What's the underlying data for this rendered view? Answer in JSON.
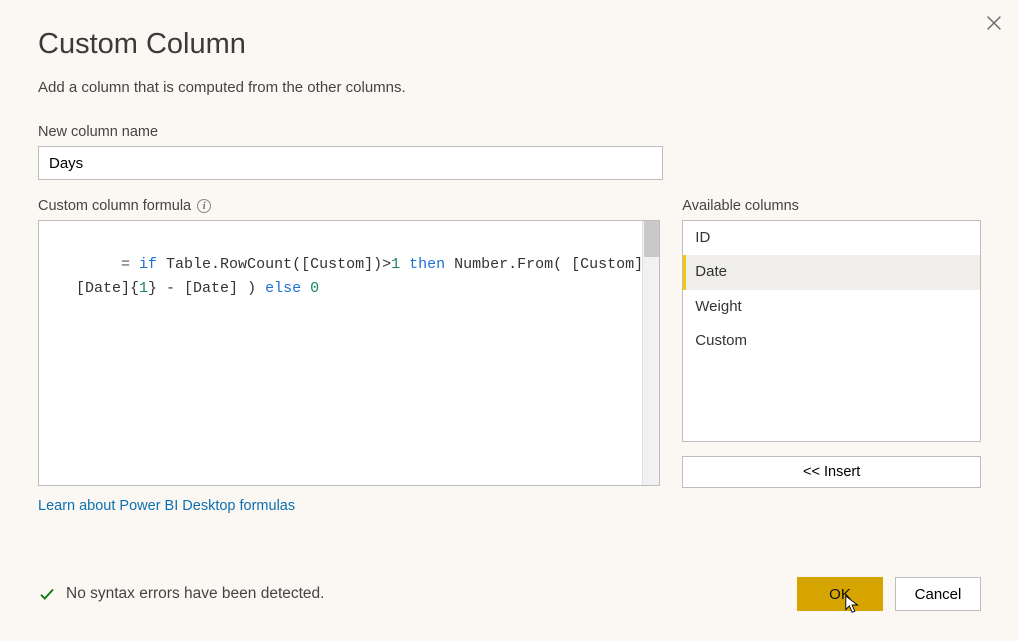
{
  "dialog": {
    "title": "Custom Column",
    "subtitle": "Add a column that is computed from the other columns.",
    "close_tooltip": "Close"
  },
  "column_name": {
    "label": "New column name",
    "value": "Days"
  },
  "formula": {
    "label": "Custom column formula",
    "prefix": "= ",
    "tokens": [
      {
        "t": "kw",
        "v": "if"
      },
      {
        "t": "txt",
        "v": " Table.RowCount([Custom])>"
      },
      {
        "t": "num",
        "v": "1"
      },
      {
        "t": "txt",
        "v": " "
      },
      {
        "t": "kw",
        "v": "then"
      },
      {
        "t": "txt",
        "v": " Number.From( [Custom]\n   [Date]{"
      },
      {
        "t": "num",
        "v": "1"
      },
      {
        "t": "txt",
        "v": "} - [Date] ) "
      },
      {
        "t": "kw",
        "v": "else"
      },
      {
        "t": "txt",
        "v": " "
      },
      {
        "t": "num",
        "v": "0"
      }
    ]
  },
  "available": {
    "label": "Available columns",
    "items": [
      {
        "name": "ID",
        "selected": false
      },
      {
        "name": "Date",
        "selected": true
      },
      {
        "name": "Weight",
        "selected": false
      },
      {
        "name": "Custom",
        "selected": false
      }
    ],
    "insert_label": "<< Insert"
  },
  "learn_link": "Learn about Power BI Desktop formulas",
  "status": {
    "message": "No syntax errors have been detected."
  },
  "buttons": {
    "ok": "OK",
    "cancel": "Cancel"
  }
}
